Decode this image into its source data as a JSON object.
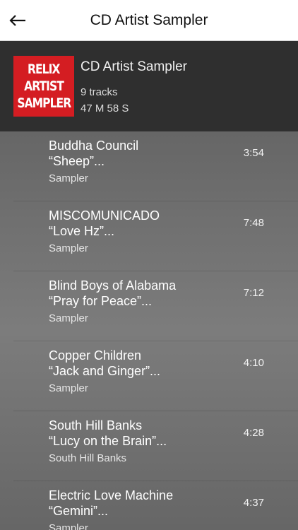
{
  "topbar": {
    "title": "CD Artist Sampler",
    "back_icon": "back-arrow-icon"
  },
  "album": {
    "art_lines": [
      "RELIX",
      "ARTIST",
      "SAMPLER"
    ],
    "art_color": "#d41d22",
    "title": "CD Artist Sampler",
    "tracks": "9 tracks",
    "duration": "47 M 58 S"
  },
  "tracks": [
    {
      "artist": "Buddha Council",
      "song": "“Sheep”...",
      "album": "Sampler",
      "time": "3:54"
    },
    {
      "artist": "MISCOMUNICADO",
      "song": "“Love Hz”...",
      "album": "Sampler",
      "time": "7:48"
    },
    {
      "artist": "Blind Boys of Alabama",
      "song": "“Pray for Peace”...",
      "album": "Sampler",
      "time": "7:12"
    },
    {
      "artist": "Copper Children",
      "song": "“Jack and Ginger”...",
      "album": "Sampler",
      "time": "4:10"
    },
    {
      "artist": "South Hill Banks",
      "song": "“Lucy on the Brain”...",
      "album": "South Hill Banks",
      "time": "4:28"
    },
    {
      "artist": "Electric Love Machine",
      "song": "“Gemini”...",
      "album": "Sampler",
      "time": "4:37"
    }
  ]
}
